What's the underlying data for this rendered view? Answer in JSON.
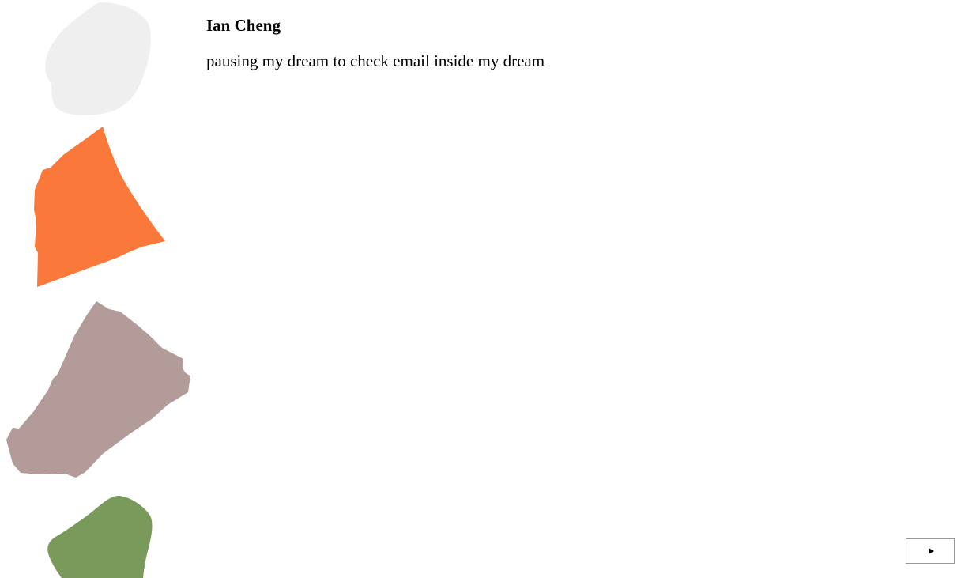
{
  "post": {
    "author": "Ian Cheng",
    "message": "pausing my dream to check email inside my dream"
  },
  "controls": {
    "play_icon": "play-icon"
  },
  "shapes": [
    {
      "name": "blob-light-gray",
      "color": "#efefef"
    },
    {
      "name": "blob-orange",
      "color": "#fa793a"
    },
    {
      "name": "blob-mauve",
      "color": "#b29b98"
    },
    {
      "name": "blob-green",
      "color": "#7a9a5c"
    }
  ]
}
